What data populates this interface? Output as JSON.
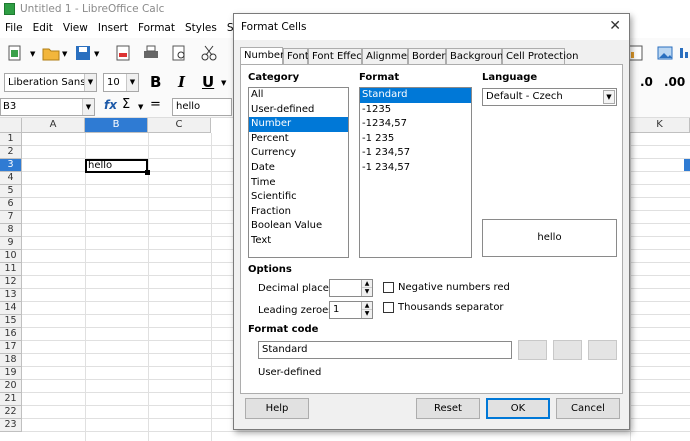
{
  "window": {
    "title": "Untitled 1 - LibreOffice Calc"
  },
  "menubar": [
    "File",
    "Edit",
    "View",
    "Insert",
    "Format",
    "Styles",
    "Sheet"
  ],
  "toolbar": {
    "font_name": "Liberation Sans",
    "font_size": "10",
    "bold": "B",
    "italic": "I",
    "underline": "U"
  },
  "formula_bar": {
    "name_box": "B3",
    "fx": "fx",
    "sum": "Σ",
    "equals": "=",
    "content": "hello"
  },
  "sheet": {
    "columns": [
      "A",
      "B",
      "C",
      "K"
    ],
    "active_column": "B",
    "rows": [
      "1",
      "2",
      "3",
      "4",
      "5",
      "6",
      "7",
      "8",
      "9",
      "10",
      "11",
      "12",
      "13",
      "14",
      "15",
      "16",
      "17",
      "18",
      "19",
      "20",
      "21",
      "22",
      "23"
    ],
    "active_row": "3",
    "cell_value": "hello"
  },
  "dialog": {
    "title": "Format Cells",
    "close": "✕",
    "tabs": [
      "Numbers",
      "Font",
      "Font Effects",
      "Alignment",
      "Borders",
      "Background",
      "Cell Protection"
    ],
    "active_tab": "Numbers",
    "category": {
      "label": "Category",
      "items": [
        "All",
        "User-defined",
        "Number",
        "Percent",
        "Currency",
        "Date",
        "Time",
        "Scientific",
        "Fraction",
        "Boolean Value",
        "Text"
      ],
      "selected": "Number"
    },
    "format": {
      "label": "Format",
      "items": [
        "Standard",
        "-1235",
        "-1234,57",
        "-1 235",
        "-1 234,57",
        "-1 234,57"
      ],
      "selected": "Standard"
    },
    "language": {
      "label": "Language",
      "value": "Default - Czech"
    },
    "preview_text": "hello",
    "options": {
      "label": "Options",
      "decimal_places_label": "Decimal places:",
      "decimal_places_value": "",
      "leading_zeroes_label": "Leading zeroes:",
      "leading_zeroes_value": "1",
      "negative_red_label": "Negative numbers red",
      "thousands_sep_label": "Thousands separator"
    },
    "format_code": {
      "label": "Format code",
      "value": "Standard",
      "status": "User-defined"
    },
    "buttons": {
      "help": "Help",
      "reset": "Reset",
      "ok": "OK",
      "cancel": "Cancel"
    }
  }
}
